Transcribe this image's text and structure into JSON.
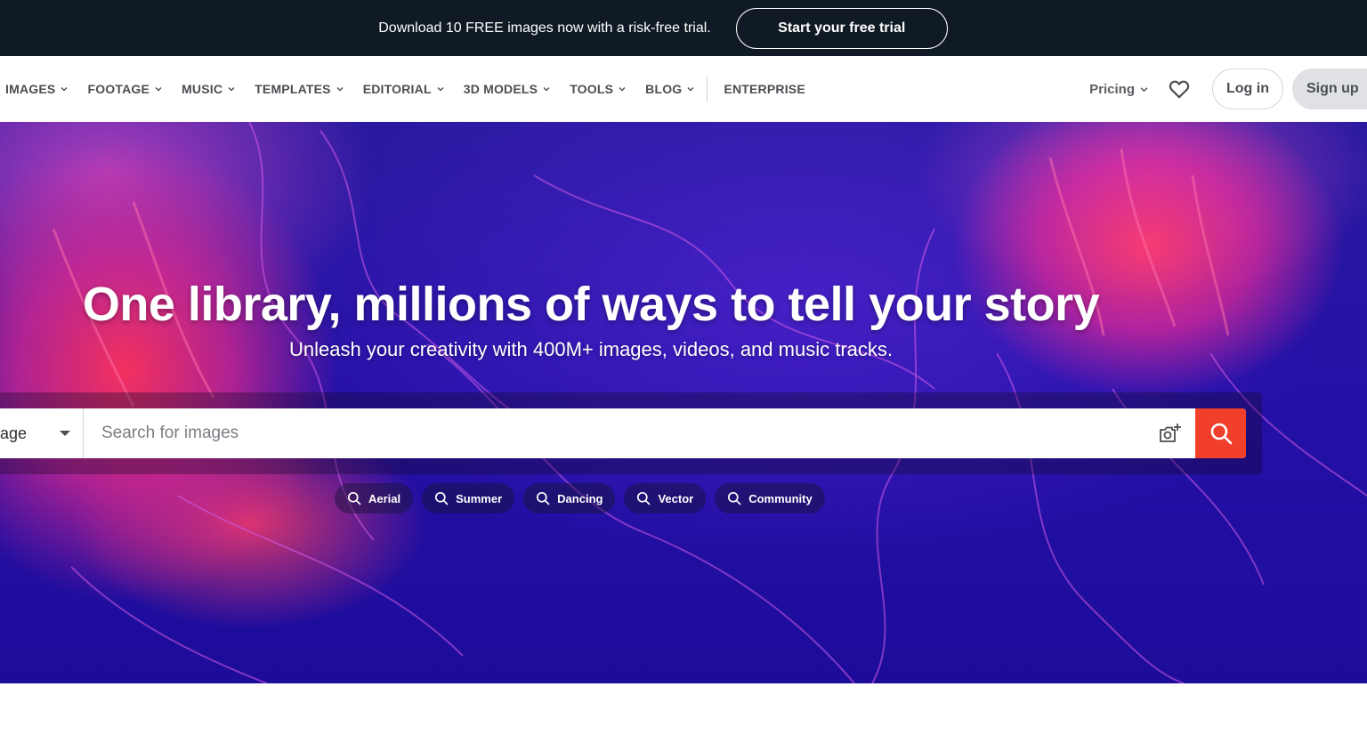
{
  "promo": {
    "text": "Download 10 FREE images now with a risk-free trial.",
    "cta_label": "Start your free trial"
  },
  "nav": {
    "items": [
      {
        "label": "IMAGES",
        "has_dropdown": true
      },
      {
        "label": "FOOTAGE",
        "has_dropdown": true
      },
      {
        "label": "MUSIC",
        "has_dropdown": true
      },
      {
        "label": "TEMPLATES",
        "has_dropdown": true
      },
      {
        "label": "EDITORIAL",
        "has_dropdown": true
      },
      {
        "label": "3D MODELS",
        "has_dropdown": true
      },
      {
        "label": "TOOLS",
        "has_dropdown": true
      },
      {
        "label": "BLOG",
        "has_dropdown": true
      }
    ],
    "enterprise_label": "ENTERPRISE",
    "pricing_label": "Pricing",
    "favorites_icon": "heart-icon",
    "login_label": "Log in",
    "signup_label": "Sign up"
  },
  "hero": {
    "title": "One library, millions of ways to tell your story",
    "subtitle": "Unleash your creativity with 400M+ images, videos, and music tracks."
  },
  "search": {
    "type_value": "age",
    "placeholder": "Search for images",
    "camera_icon": "camera-plus-icon",
    "search_icon": "search-icon",
    "button_color": "#f23f2c"
  },
  "chips": [
    {
      "label": "Aerial"
    },
    {
      "label": "Summer"
    },
    {
      "label": "Dancing"
    },
    {
      "label": "Vector"
    },
    {
      "label": "Community"
    }
  ],
  "colors": {
    "promo_bg": "#101a24",
    "accent": "#f23f2c"
  }
}
